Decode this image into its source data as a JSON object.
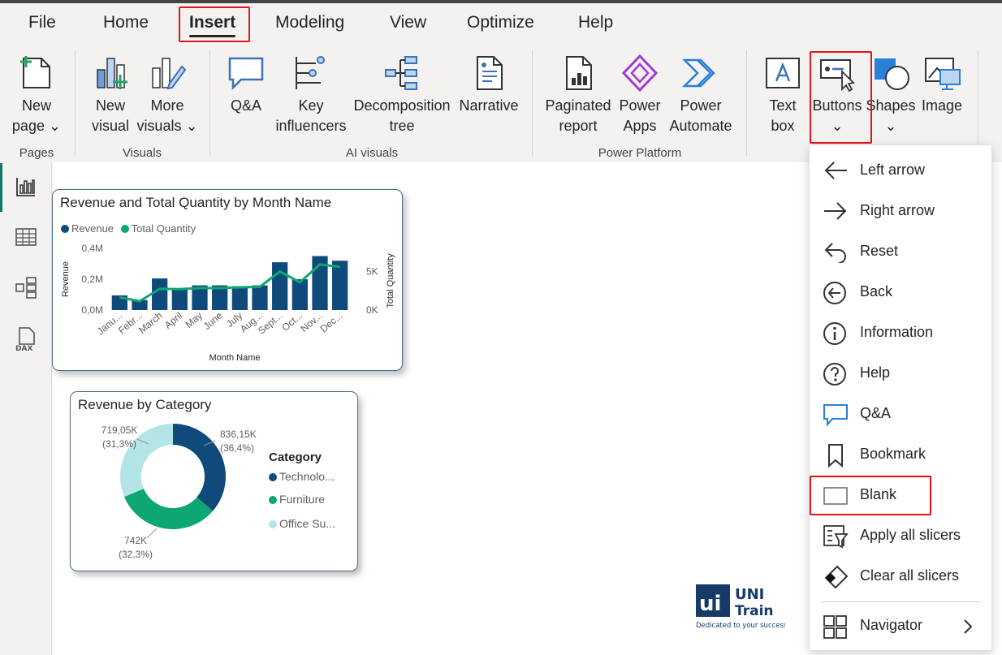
{
  "menu": {
    "tabs": [
      {
        "label": "File"
      },
      {
        "label": "Home"
      },
      {
        "label": "Insert"
      },
      {
        "label": "Modeling"
      },
      {
        "label": "View"
      },
      {
        "label": "Optimize"
      },
      {
        "label": "Help"
      }
    ],
    "active_tab": "Insert"
  },
  "ribbon": {
    "groups": {
      "pages": "Pages",
      "visuals": "Visuals",
      "ai_visuals": "AI visuals",
      "power_platform": "Power Platform"
    },
    "buttons": {
      "new_page": [
        "New",
        "page"
      ],
      "new_visual": [
        "New",
        "visual"
      ],
      "more_visuals": [
        "More",
        "visuals"
      ],
      "qna": [
        "Q&A"
      ],
      "key_influencers": [
        "Key",
        "influencers"
      ],
      "decomposition_tree": [
        "Decomposition",
        "tree"
      ],
      "narrative": [
        "Narrative"
      ],
      "paginated_report": [
        "Paginated",
        "report"
      ],
      "power_apps": [
        "Power",
        "Apps"
      ],
      "power_automate": [
        "Power",
        "Automate"
      ],
      "text_box": [
        "Text",
        "box"
      ],
      "buttons": [
        "Buttons"
      ],
      "shapes": [
        "Shapes"
      ],
      "image": [
        "Image"
      ]
    }
  },
  "buttons_menu": {
    "items": [
      {
        "label": "Left arrow",
        "icon": "left-arrow-icon"
      },
      {
        "label": "Right arrow",
        "icon": "right-arrow-icon"
      },
      {
        "label": "Reset",
        "icon": "reset-icon"
      },
      {
        "label": "Back",
        "icon": "back-icon"
      },
      {
        "label": "Information",
        "icon": "information-icon"
      },
      {
        "label": "Help",
        "icon": "help-icon"
      },
      {
        "label": "Q&A",
        "icon": "qna-icon"
      },
      {
        "label": "Bookmark",
        "icon": "bookmark-icon"
      },
      {
        "label": "Blank",
        "icon": "blank-icon"
      },
      {
        "label": "Apply all slicers",
        "icon": "apply-slicers-icon"
      },
      {
        "label": "Clear all slicers",
        "icon": "clear-slicers-icon"
      },
      {
        "label": "Navigator",
        "icon": "navigator-icon"
      }
    ],
    "highlighted": "Blank"
  },
  "colors": {
    "revenue": "#0f4a7a",
    "quantity": "#0ea672",
    "office": "#b4e5e6",
    "highlight": "#e0141e",
    "rail_active": "#117865"
  },
  "chart_data": [
    {
      "type": "bar",
      "title": "Revenue and Total Quantity by Month Name",
      "xlabel": "Month Name",
      "ylabel": "Revenue",
      "y2label": "Total Quantity",
      "legend": [
        "Revenue",
        "Total Quantity"
      ],
      "yticks": [
        "0,0M",
        "0,2M",
        "0,4M"
      ],
      "y2ticks": [
        "0K",
        "5K"
      ],
      "ylim": [
        0,
        0.4
      ],
      "y2lim": [
        0,
        8000
      ],
      "categories": [
        "Janu...",
        "Febr...",
        "March",
        "April",
        "May",
        "June",
        "July",
        "Aug...",
        "Sept...",
        "Oct...",
        "Nov...",
        "Dec..."
      ],
      "series": [
        {
          "name": "Revenue",
          "type": "bar",
          "values": [
            0.095,
            0.065,
            0.205,
            0.14,
            0.16,
            0.16,
            0.155,
            0.16,
            0.31,
            0.2,
            0.35,
            0.32
          ]
        },
        {
          "name": "Total Quantity",
          "type": "line",
          "axis": "y2",
          "values": [
            1650,
            1150,
            2750,
            2700,
            2850,
            2850,
            2950,
            3000,
            5000,
            3600,
            5900,
            5600
          ]
        }
      ]
    },
    {
      "type": "pie",
      "title": "Revenue by Category",
      "legend_title": "Category",
      "labels": [
        "Technolo...",
        "Furniture",
        "Office Su..."
      ],
      "values": [
        836.15,
        742,
        719.05
      ],
      "data_labels": [
        [
          "836,15K",
          "(36,4%)"
        ],
        [
          "742K",
          "(32,3%)"
        ],
        [
          "719,05K",
          "(31,3%)"
        ]
      ],
      "legend_placement": "right"
    }
  ],
  "logo": {
    "brand1": "UNI",
    "brand2": "Train",
    "tagline": "Dedicated to your success"
  }
}
